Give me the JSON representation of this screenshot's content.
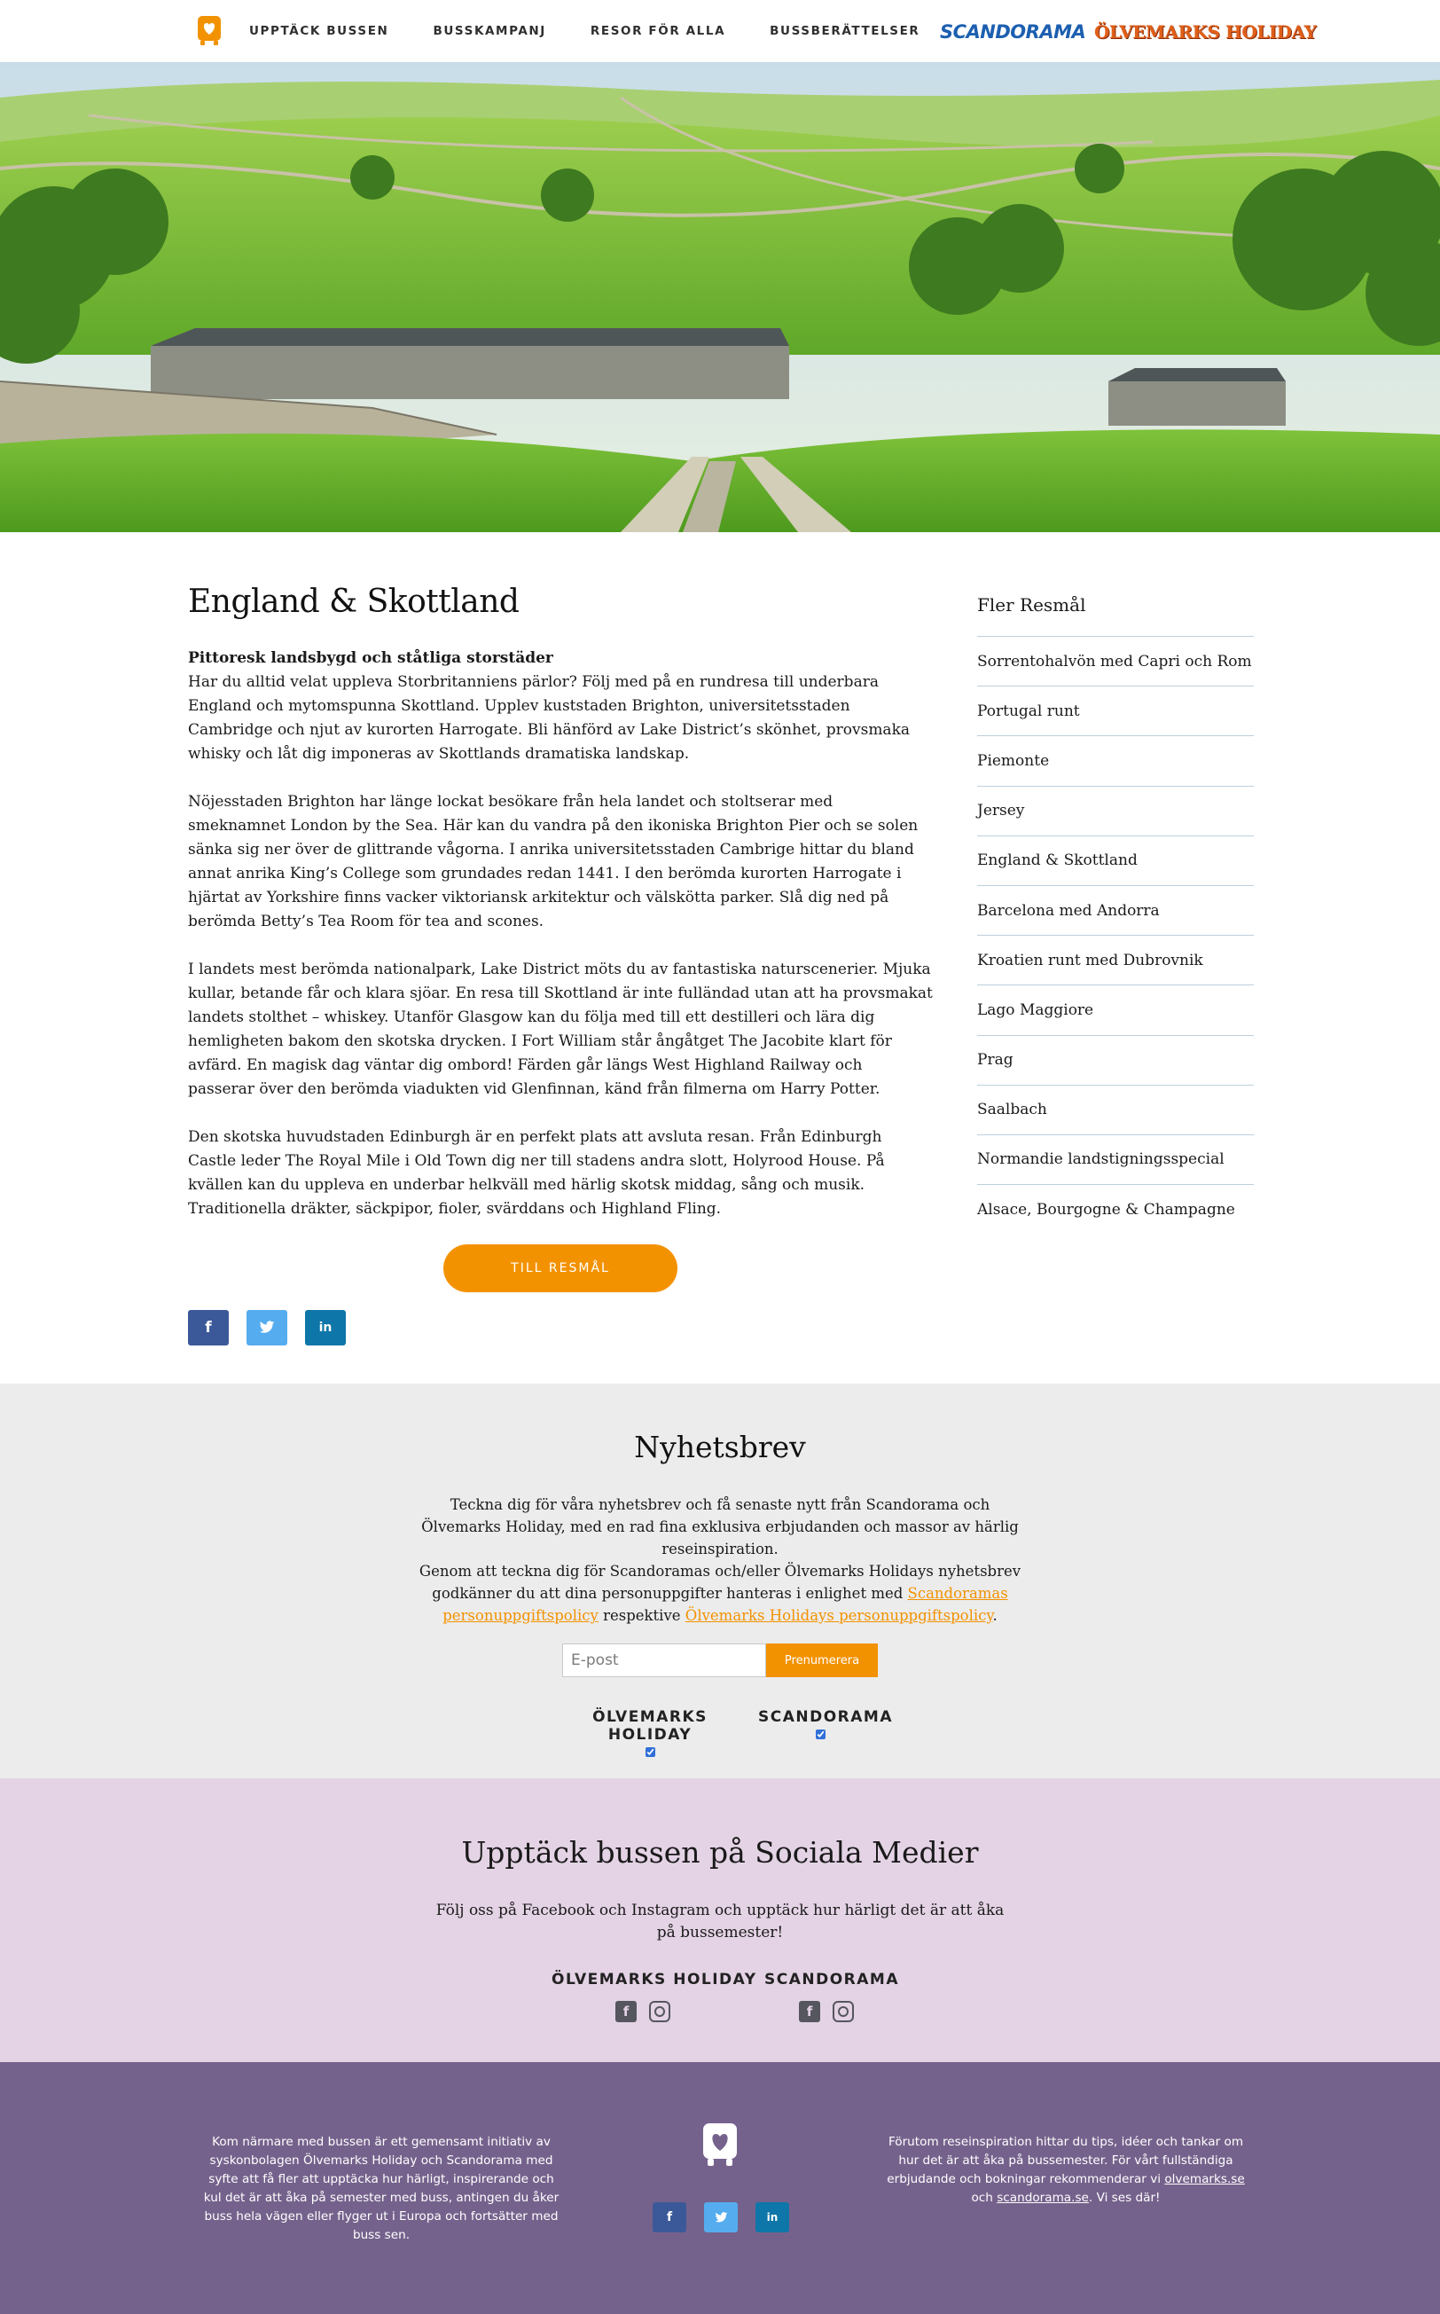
{
  "header": {
    "logo_icon": "bus-heart-icon",
    "nav": [
      {
        "label": "UPPTÄCK BUSSEN"
      },
      {
        "label": "BUSSKAMPANJ"
      },
      {
        "label": "RESOR FÖR ALLA"
      },
      {
        "label": "BUSSBERÄTTELSER"
      }
    ],
    "brands": {
      "scandorama": "SCANDORAMA",
      "olvemarks": "ÖLVEMARKS HOLIDAY"
    }
  },
  "article": {
    "title": "England & Skottland",
    "lead": "Pittoresk landsbygd och ståtliga storstäder",
    "paragraphs": [
      "Har du alltid velat uppleva Storbritanniens pärlor? Följ med på en rundresa till underbara England och mytomspunna Skottland. Upplev kuststaden Brighton, universitetsstaden Cambridge och njut av kurorten Harrogate. Bli hänförd av Lake District’s skönhet, provsmaka whisky och låt dig imponeras av Skottlands dramatiska landskap.",
      "Nöjesstaden Brighton har länge lockat besökare från hela landet och stoltserar med smeknamnet London by the Sea. Här kan du vandra på den ikoniska Brighton Pier och se solen sänka sig ner över de glittrande vågorna. I anrika universitetsstaden Cambrige hittar du bland annat anrika King’s College som grundades redan 1441. I den berömda kurorten Harrogate i hjärtat av Yorkshire finns vacker viktoriansk arkitektur och välskötta parker. Slå dig ned på berömda Betty’s Tea Room för tea and scones.",
      "I landets mest berömda nationalpark, Lake District möts du av fantastiska naturscenerier. Mjuka kullar, betande får och klara sjöar. En resa till Skottland är inte fulländad utan att ha provsmakat landets stolthet – whiskey. Utanför Glasgow kan du följa med till ett destilleri och lära dig hemligheten bakom den skotska drycken. I Fort William står ångåtget The Jacobite klart för avfärd. En magisk dag väntar dig ombord! Färden går längs West Highland Railway och passerar över den berömda viadukten vid Glenfinnan, känd från filmerna om Harry Potter.",
      "Den skotska huvudstaden Edinburgh är en perfekt plats att avsluta resan. Från Edinburgh Castle leder The Royal Mile i Old Town dig ner till stadens andra slott, Holyrood House. På kvällen kan du uppleva en underbar helkväll med härlig skotsk middag, sång och musik. Traditionella dräkter, säckpipor, fioler, svärddans och Highland Fling."
    ],
    "cta": "TILL RESMÅL",
    "share": [
      {
        "icon": "facebook-icon",
        "glyph": "f",
        "color": "#3b5998"
      },
      {
        "icon": "twitter-icon",
        "glyph": "t",
        "color": "#55acee"
      },
      {
        "icon": "linkedin-icon",
        "glyph": "in",
        "color": "#0e76a8"
      }
    ]
  },
  "sidebar": {
    "title": "Fler Resmål",
    "items": [
      "Sorrentohalvön med Capri och Rom",
      "Portugal runt",
      "Piemonte",
      "Jersey",
      "England & Skottland",
      "Barcelona med Andorra",
      "Kroatien runt med Dubrovnik",
      "Lago Maggiore",
      "Prag",
      "Saalbach",
      "Normandie landstigningsspecial",
      "Alsace, Bourgogne & Champagne"
    ]
  },
  "newsletter": {
    "title": "Nyhetsbrev",
    "text1": "Teckna dig för våra nyhetsbrev och få senaste nytt från Scandorama och Ölvemarks Holiday, med en rad fina exklusiva erbjudanden och massor av härlig reseinspiration.",
    "text2_before": "Genom att teckna dig för Scandoramas och/eller Ölvemarks Holidays nyhetsbrev godkänner du att dina personuppgifter hanteras i enlighet med ",
    "link1": "Scandoramas personuppgiftspolicy",
    "text2_middle": " respektive ",
    "link2": "Ölvemarks Holidays personuppgiftspolicy",
    "text2_after": ".",
    "email_placeholder": "E-post",
    "subscribe": "Prenumerera",
    "options": [
      "ÖLVEMARKS HOLIDAY",
      "SCANDORAMA"
    ]
  },
  "social": {
    "title": "Upptäck bussen på Sociala Medier",
    "text": "Följ oss på Facebook och Instagram och upptäck hur härligt det är att åka på bussemester!",
    "columns": [
      "ÖLVEMARKS HOLIDAY",
      "SCANDORAMA"
    ]
  },
  "footer": {
    "left": "Kom närmare med bussen är ett gemensamt initiativ av syskonbolagen Ölvemarks Holiday och Scandorama med syfte att få fler att upptäcka hur härligt, inspirerande och kul det är att åka på semester med buss, antingen du åker buss hela vägen eller flyger ut i Europa och fortsätter med buss sen.",
    "right_before": "Förutom reseinspiration hittar du tips, idéer och tankar om hur det är att åka på bussemester. För vårt fullständiga erbjudande och bokningar rekommenderar vi ",
    "right_link1": "olvemarks.se",
    "right_middle": " och ",
    "right_link2": "scandorama.se",
    "right_after": ". Vi ses där!"
  }
}
